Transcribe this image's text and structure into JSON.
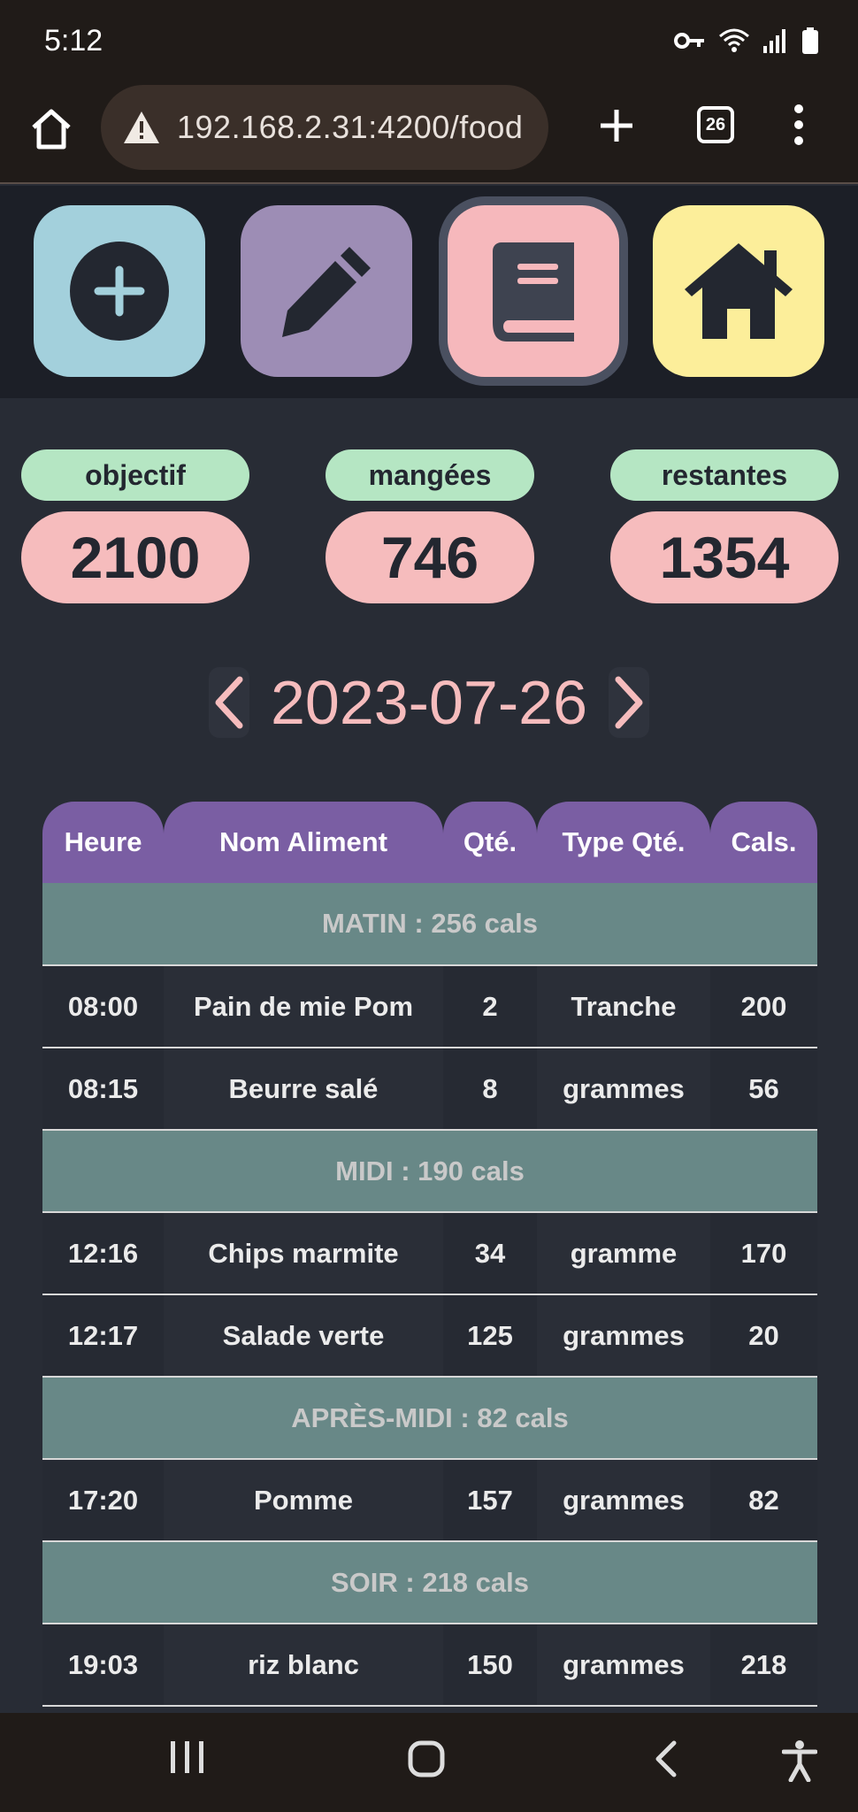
{
  "status": {
    "time": "5:12"
  },
  "browser": {
    "url": "192.168.2.31:4200/food",
    "tab_count": "26"
  },
  "nav": {
    "items": [
      {
        "name": "add",
        "color": "#a3d0dc"
      },
      {
        "name": "edit",
        "color": "#9d8db5"
      },
      {
        "name": "journal",
        "color": "#f6b8bc",
        "active": true
      },
      {
        "name": "home",
        "color": "#fcee9a"
      }
    ]
  },
  "stats": {
    "goal_label": "objectif",
    "goal_value": "2100",
    "eaten_label": "mangées",
    "eaten_value": "746",
    "remaining_label": "restantes",
    "remaining_value": "1354"
  },
  "date": {
    "current": "2023-07-26"
  },
  "table": {
    "headers": [
      "Heure",
      "Nom Aliment",
      "Qté.",
      "Type Qté.",
      "Cals."
    ],
    "rows": [
      {
        "type": "meal",
        "label": "MATIN : 256 cals"
      },
      {
        "type": "item",
        "cells": [
          "08:00",
          "Pain de mie Pom",
          "2",
          "Tranche",
          "200"
        ]
      },
      {
        "type": "item",
        "cells": [
          "08:15",
          "Beurre salé",
          "8",
          "grammes",
          "56"
        ]
      },
      {
        "type": "meal",
        "label": "MIDI : 190 cals"
      },
      {
        "type": "item",
        "cells": [
          "12:16",
          "Chips marmite",
          "34",
          "gramme",
          "170"
        ]
      },
      {
        "type": "item",
        "cells": [
          "12:17",
          "Salade verte",
          "125",
          "grammes",
          "20"
        ]
      },
      {
        "type": "meal",
        "label": "APRÈS-MIDI : 82 cals"
      },
      {
        "type": "item",
        "cells": [
          "17:20",
          "Pomme",
          "157",
          "grammes",
          "82"
        ]
      },
      {
        "type": "meal",
        "label": "SOIR : 218 cals"
      },
      {
        "type": "item",
        "cells": [
          "19:03",
          "riz blanc",
          "150",
          "grammes",
          "218"
        ]
      }
    ]
  },
  "colors": {
    "header_purple": "#7a5ea3",
    "meal_row": "#688887",
    "label_green": "#b5e6c3",
    "value_pink": "#f6bcbd"
  }
}
